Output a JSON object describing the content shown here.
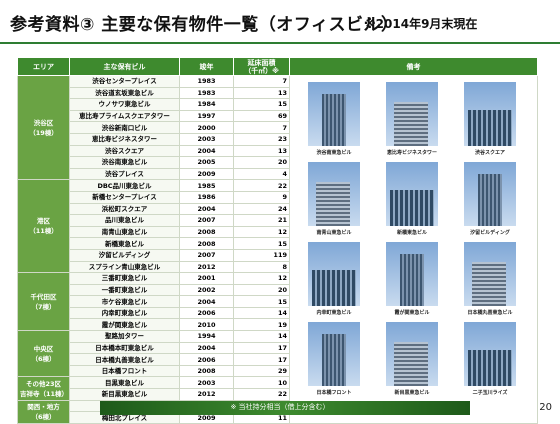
{
  "title": "参考資料③ 主要な保有物件一覧（オフィスビル）",
  "as_of": "※2014年9月末現在",
  "headers": [
    "エリア",
    "主な保有ビル",
    "竣年",
    "延床面積\n（千㎡）※",
    "備考"
  ],
  "areas": [
    {
      "label": "渋谷区\n（19棟）",
      "rows": [
        [
          "渋谷センタープレイス",
          "1983",
          "7"
        ],
        [
          "渋谷道玄坂東急ビル",
          "1983",
          "13"
        ],
        [
          "ウノサワ東急ビル",
          "1984",
          "15"
        ],
        [
          "恵比寿プライムスクエアタワー",
          "1997",
          "69"
        ],
        [
          "渋谷新南口ビル",
          "2000",
          "7"
        ],
        [
          "恵比寿ビジネスタワー",
          "2003",
          "23"
        ],
        [
          "渋谷スクエア",
          "2004",
          "13"
        ],
        [
          "渋谷南東急ビル",
          "2005",
          "20"
        ],
        [
          "渋谷プレイス",
          "2009",
          "4"
        ]
      ]
    },
    {
      "label": "港区\n（11棟）",
      "rows": [
        [
          "DBC品川東急ビル",
          "1985",
          "22"
        ],
        [
          "新橋センタープレイス",
          "1986",
          "9"
        ],
        [
          "浜松町スクエア",
          "2004",
          "24"
        ],
        [
          "品川東急ビル",
          "2007",
          "21"
        ],
        [
          "南青山東急ビル",
          "2008",
          "12"
        ],
        [
          "新橋東急ビル",
          "2008",
          "15"
        ],
        [
          "汐留ビルディング",
          "2007",
          "119"
        ],
        [
          "スプライン青山東急ビル",
          "2012",
          "8"
        ]
      ]
    },
    {
      "label": "千代田区\n（7棟）",
      "rows": [
        [
          "三番町東急ビル",
          "2001",
          "12"
        ],
        [
          "一番町東急ビル",
          "2002",
          "20"
        ],
        [
          "市ケ谷東急ビル",
          "2004",
          "15"
        ],
        [
          "内幸町東急ビル",
          "2006",
          "14"
        ],
        [
          "霞が関東急ビル",
          "2010",
          "19"
        ]
      ]
    },
    {
      "label": "中央区\n（6棟）",
      "rows": [
        [
          "聖路加タワー",
          "1994",
          "14"
        ],
        [
          "日本橋本町東急ビル",
          "2004",
          "17"
        ],
        [
          "日本橋丸善東急ビル",
          "2006",
          "17"
        ],
        [
          "日本橋フロント",
          "2008",
          "29"
        ]
      ]
    },
    {
      "label": "その他23区\n吉祥寺（11棟）",
      "rows": [
        [
          "目黒東急ビル",
          "2003",
          "10"
        ],
        [
          "新目黒東急ビル",
          "2012",
          "22"
        ]
      ]
    },
    {
      "label": "関西・地方\n（6棟）",
      "rows": [
        [
          "心斎橋東急ビル",
          "1982",
          "11"
        ],
        [
          "梅田北プレイス",
          "2009",
          "11"
        ]
      ]
    }
  ],
  "photos": [
    "渋谷南東急ビル",
    "恵比寿ビジネスタワー",
    "渋谷スクエア",
    "南青山東急ビル",
    "新橋東急ビル",
    "汐留ビルディング",
    "内幸町東急ビル",
    "霞が関東急ビル",
    "日本橋丸善東急ビル",
    "日本橋フロント",
    "新目黒東急ビル",
    "二子玉川ライズ"
  ],
  "footer_note": "※ 当社持分相当（借上分含む）",
  "page_number": "20"
}
